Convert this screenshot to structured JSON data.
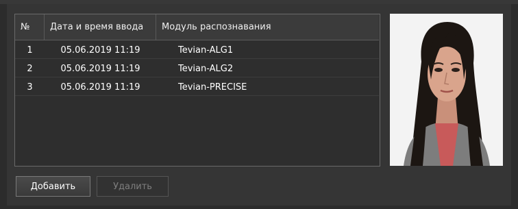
{
  "table": {
    "headers": [
      "№",
      "Дата и время ввода",
      "Модуль распознавания"
    ],
    "rows": [
      {
        "n": "1",
        "datetime": "05.06.2019 11:19",
        "module": "Tevian-ALG1"
      },
      {
        "n": "2",
        "datetime": "05.06.2019 11:19",
        "module": "Tevian-ALG2"
      },
      {
        "n": "3",
        "datetime": "05.06.2019 11:19",
        "module": "Tevian-PRECISE"
      }
    ]
  },
  "buttons": {
    "add_label": "Добавить",
    "delete_label": "Удалить"
  },
  "colors": {
    "background": "#2c2c2c",
    "panel": "#353535",
    "disabled_text": "#7f7f7f"
  },
  "photo": {
    "icon": "face-photo"
  }
}
